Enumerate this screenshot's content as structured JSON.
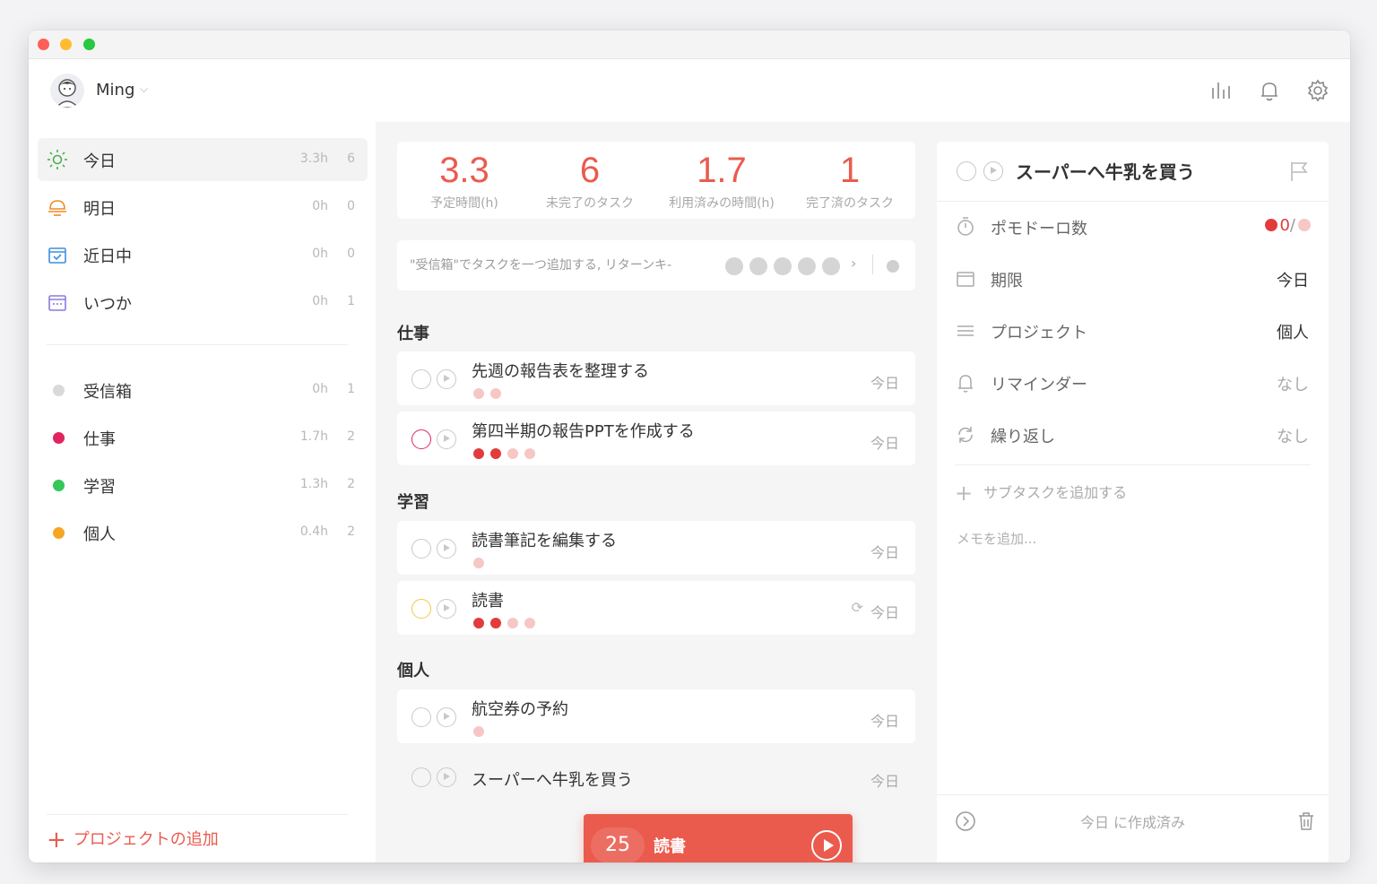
{
  "user": {
    "name": "Ming"
  },
  "sidebar": {
    "items": [
      {
        "label": "今日",
        "hours": "3.3h",
        "count": "6"
      },
      {
        "label": "明日",
        "hours": "0h",
        "count": "0"
      },
      {
        "label": "近日中",
        "hours": "0h",
        "count": "0"
      },
      {
        "label": "いつか",
        "hours": "0h",
        "count": "1"
      }
    ],
    "projects": [
      {
        "label": "受信箱",
        "hours": "0h",
        "count": "1",
        "color": "#d9d9d9"
      },
      {
        "label": "仕事",
        "hours": "1.7h",
        "count": "2",
        "color": "#e0245e"
      },
      {
        "label": "学習",
        "hours": "1.3h",
        "count": "2",
        "color": "#34c759"
      },
      {
        "label": "個人",
        "hours": "0.4h",
        "count": "2",
        "color": "#f5a623"
      }
    ],
    "add_project_label": "プロジェクトの追加"
  },
  "stats": [
    {
      "value": "3.3",
      "label": "予定時間(h)"
    },
    {
      "value": "6",
      "label": "未完了のタスク"
    },
    {
      "value": "1.7",
      "label": "利用済みの時間(h)"
    },
    {
      "value": "1",
      "label": "完了済のタスク"
    }
  ],
  "quick_add": {
    "placeholder": "\"受信箱\"でタスクを一つ追加する, リターンキ-"
  },
  "groups": [
    {
      "title": "仕事",
      "tasks": [
        {
          "title": "先週の報告表を整理する",
          "due": "今日"
        },
        {
          "title": "第四半期の報告PPTを作成する",
          "due": "今日"
        }
      ]
    },
    {
      "title": "学習",
      "tasks": [
        {
          "title": "読書筆記を編集する",
          "due": "今日"
        },
        {
          "title": "読書",
          "due": "今日"
        }
      ]
    },
    {
      "title": "個人",
      "tasks": [
        {
          "title": "航空券の予約",
          "due": "今日"
        },
        {
          "title": "スーパーへ牛乳を買う",
          "due": "今日"
        }
      ]
    }
  ],
  "pomodoro_bar": {
    "minutes": "25",
    "task": "読書"
  },
  "detail": {
    "title": "スーパーへ牛乳を買う",
    "pomodoro_label": "ポモドーロ数",
    "pomodoro_value": "0",
    "pomodoro_sep": "/",
    "due_label": "期限",
    "due_value": "今日",
    "project_label": "プロジェクト",
    "project_value": "個人",
    "reminder_label": "リマインダー",
    "reminder_value": "なし",
    "repeat_label": "繰り返し",
    "repeat_value": "なし",
    "subtask_label": "サブタスクを追加する",
    "note_label": "メモを追加...",
    "footer_text": "今日 に作成済み"
  },
  "colors": {
    "accent": "#ea5b4e",
    "tomato_filled": "#e23b3b",
    "tomato_empty": "#f6c7c5"
  }
}
